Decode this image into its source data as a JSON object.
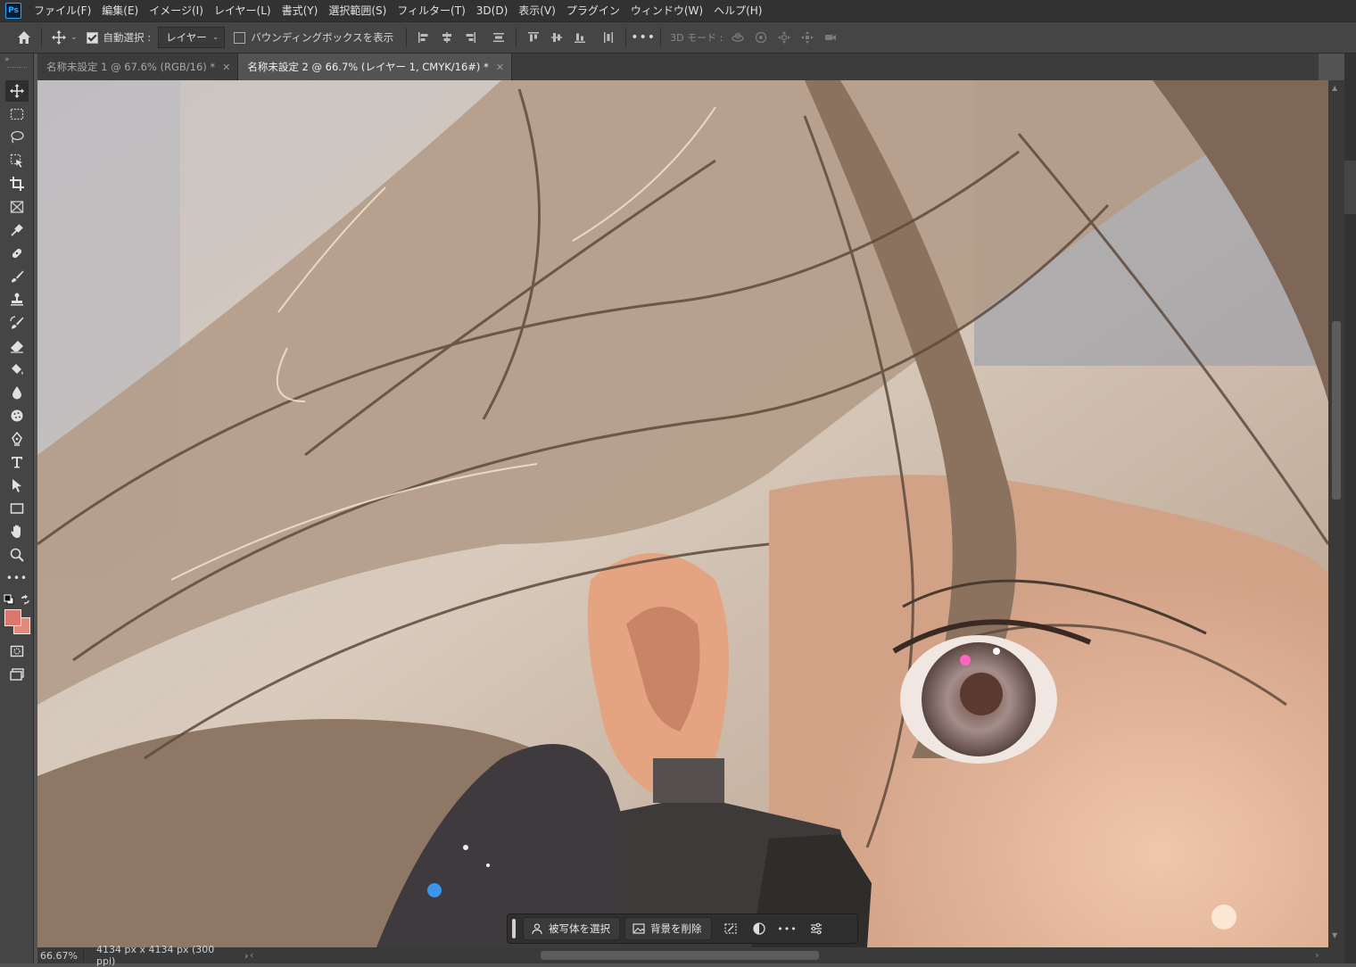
{
  "menubar": {
    "items": [
      "ファイル(F)",
      "編集(E)",
      "イメージ(I)",
      "レイヤー(L)",
      "書式(Y)",
      "選択範囲(S)",
      "フィルター(T)",
      "3D(D)",
      "表示(V)",
      "プラグイン",
      "ウィンドウ(W)",
      "ヘルプ(H)"
    ],
    "logo": "Ps"
  },
  "options": {
    "auto_select_label": "自動選択 :",
    "auto_select_target": "レイヤー",
    "bounding_box_label": "バウンディングボックスを表示",
    "mode_3d_label": "3D モード :"
  },
  "tabs": [
    {
      "label": "名称未設定 1 @ 67.6% (RGB/16) *"
    },
    {
      "label": "名称未設定 2 @ 66.7% (レイヤー 1, CMYK/16#) *"
    }
  ],
  "status": {
    "zoom": "66.67%",
    "doc_info": "4134 px x 4134 px (300 ppi)"
  },
  "contextbar": {
    "select_subject": "被写体を選択",
    "remove_background": "背景を削除"
  },
  "colors": {
    "foreground": "#d9786c",
    "background": "#e08a7e"
  }
}
